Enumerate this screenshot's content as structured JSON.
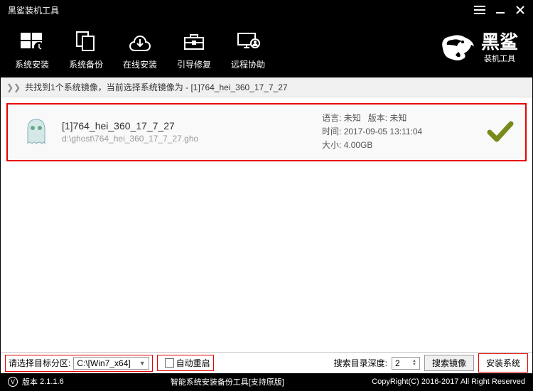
{
  "window": {
    "title": "黑鲨装机工具"
  },
  "toolbar": {
    "items": [
      {
        "label": "系统安装"
      },
      {
        "label": "系统备份"
      },
      {
        "label": "在线安装"
      },
      {
        "label": "引导修复"
      },
      {
        "label": "远程协助"
      }
    ]
  },
  "logo": {
    "main": "黑鲨",
    "sub": "装机工具"
  },
  "infobar": {
    "text": "共找到1个系统镜像，当前选择系统镜像为 - [1]764_hei_360_17_7_27"
  },
  "image": {
    "title": "[1]764_hei_360_17_7_27",
    "path": "d:\\ghost\\764_hei_360_17_7_27.gho",
    "lang_label": "语言:",
    "lang_value": "未知",
    "ver_label": "版本:",
    "ver_value": "未知",
    "time_label": "时间:",
    "time_value": "2017-09-05 13:11:04",
    "size_label": "大小:",
    "size_value": "4.00GB"
  },
  "bottom": {
    "partition_label": "请选择目标分区:",
    "partition_value": "C:\\[Win7_x64]",
    "auto_reboot": "自动重启",
    "depth_label": "搜索目录深度:",
    "depth_value": "2",
    "search_btn": "搜索镜像",
    "install_btn": "安装系统"
  },
  "status": {
    "version_label": "版本",
    "version": "2.1.1.6",
    "center": "智能系统安装备份工具[支持原版]",
    "copyright": "CopyRight(C) 2016-2017 All Right Reserved"
  }
}
